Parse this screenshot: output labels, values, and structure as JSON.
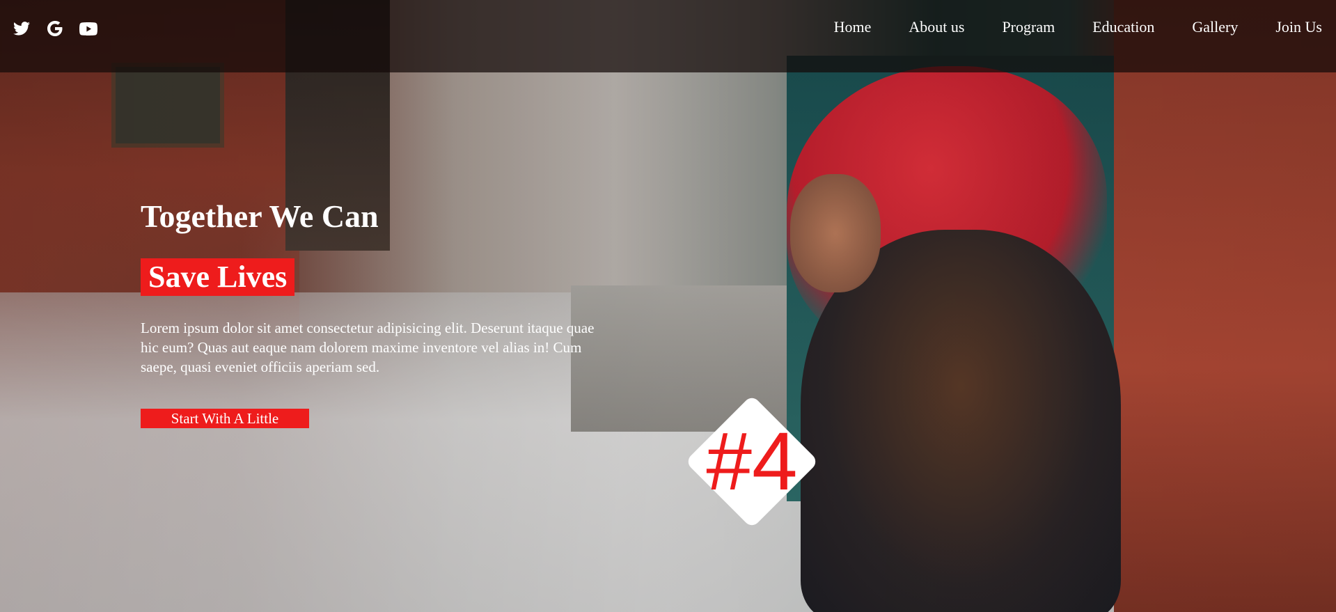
{
  "colors": {
    "accent": "#ee1c1c",
    "topbar": "#140a08",
    "text": "#ffffff"
  },
  "socials": [
    {
      "icon": "twitter-icon"
    },
    {
      "icon": "google-icon"
    },
    {
      "icon": "youtube-icon"
    }
  ],
  "nav": {
    "items": [
      {
        "label": "Home"
      },
      {
        "label": "About us"
      },
      {
        "label": "Program"
      },
      {
        "label": "Education"
      },
      {
        "label": "Gallery"
      },
      {
        "label": "Join Us"
      }
    ]
  },
  "hero": {
    "title": "Together We Can",
    "highlight": "Save Lives",
    "description": "Lorem ipsum dolor sit amet consectetur adipisicing elit. Deserunt itaque quae hic eum? Quas aut eaque nam dolorem maxime inventore vel alias in! Cum saepe, quasi eveniet officiis aperiam sed.",
    "cta_label": "Start With A Little",
    "badge": "#4"
  }
}
